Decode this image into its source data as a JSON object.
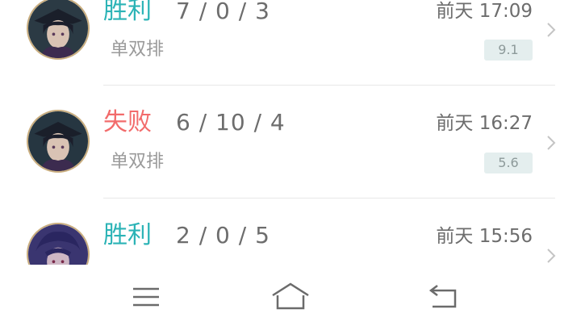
{
  "matches": [
    {
      "result": "胜利",
      "kda": "7 / 0 / 3",
      "mode": "单双排",
      "time": "前天 17:09",
      "score": "9.1",
      "result_color": "#2bb3b6"
    },
    {
      "result": "失败",
      "kda": "6 / 10 / 4",
      "mode": "单双排",
      "time": "前天 16:27",
      "score": "5.6",
      "result_color": "#f26b6b"
    },
    {
      "result": "胜利",
      "kda": "2 / 0 / 5",
      "mode": "",
      "time": "前天 15:56",
      "score": "",
      "result_color": "#2bb3b6"
    }
  ],
  "nav": {
    "icons": [
      "menu-icon",
      "home-icon",
      "back-icon"
    ]
  }
}
